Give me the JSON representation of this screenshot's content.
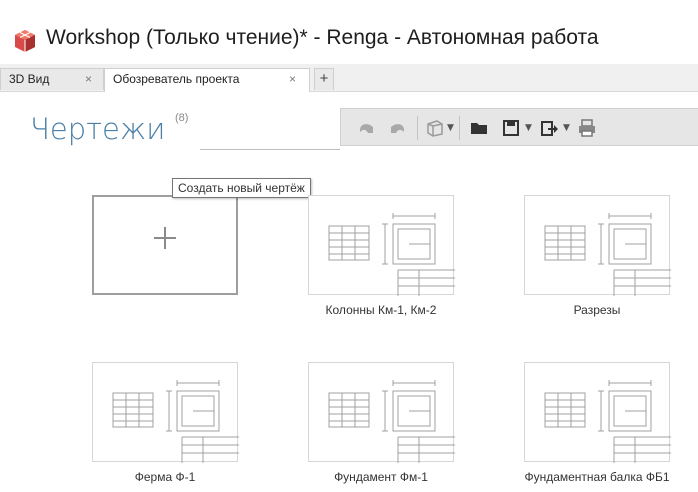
{
  "window": {
    "title": "Workshop (Только чтение)* - Renga - Автономная работа"
  },
  "tabs": [
    {
      "label": "3D Вид",
      "active": false
    },
    {
      "label": "Обозреватель проекта",
      "active": true
    }
  ],
  "tab_close_glyph": "×",
  "tab_add_glyph": "+",
  "section": {
    "title": "Чертежи",
    "count": "(8)"
  },
  "toolbar": {
    "icons": [
      "undo-icon",
      "redo-icon",
      "3d-view-icon",
      "folder-icon",
      "save-icon",
      "export-icon",
      "print-icon"
    ]
  },
  "new_drawing": {
    "icon": "plus-icon",
    "tooltip": "Создать новый чертёж"
  },
  "drawings": [
    {
      "label": "Колонны Км-1, Км-2"
    },
    {
      "label": "Разрезы"
    },
    {
      "label": "Ферма Ф-1"
    },
    {
      "label": "Фундамент Фм-1"
    },
    {
      "label": "Фундаментная балка ФБ1"
    }
  ],
  "colors": {
    "section_title": "#4a7fa8",
    "toolbar_bg": "#e6e6e6",
    "thumbnail_lines": "#9a9a9a",
    "app_icon": "#d84a4a"
  }
}
